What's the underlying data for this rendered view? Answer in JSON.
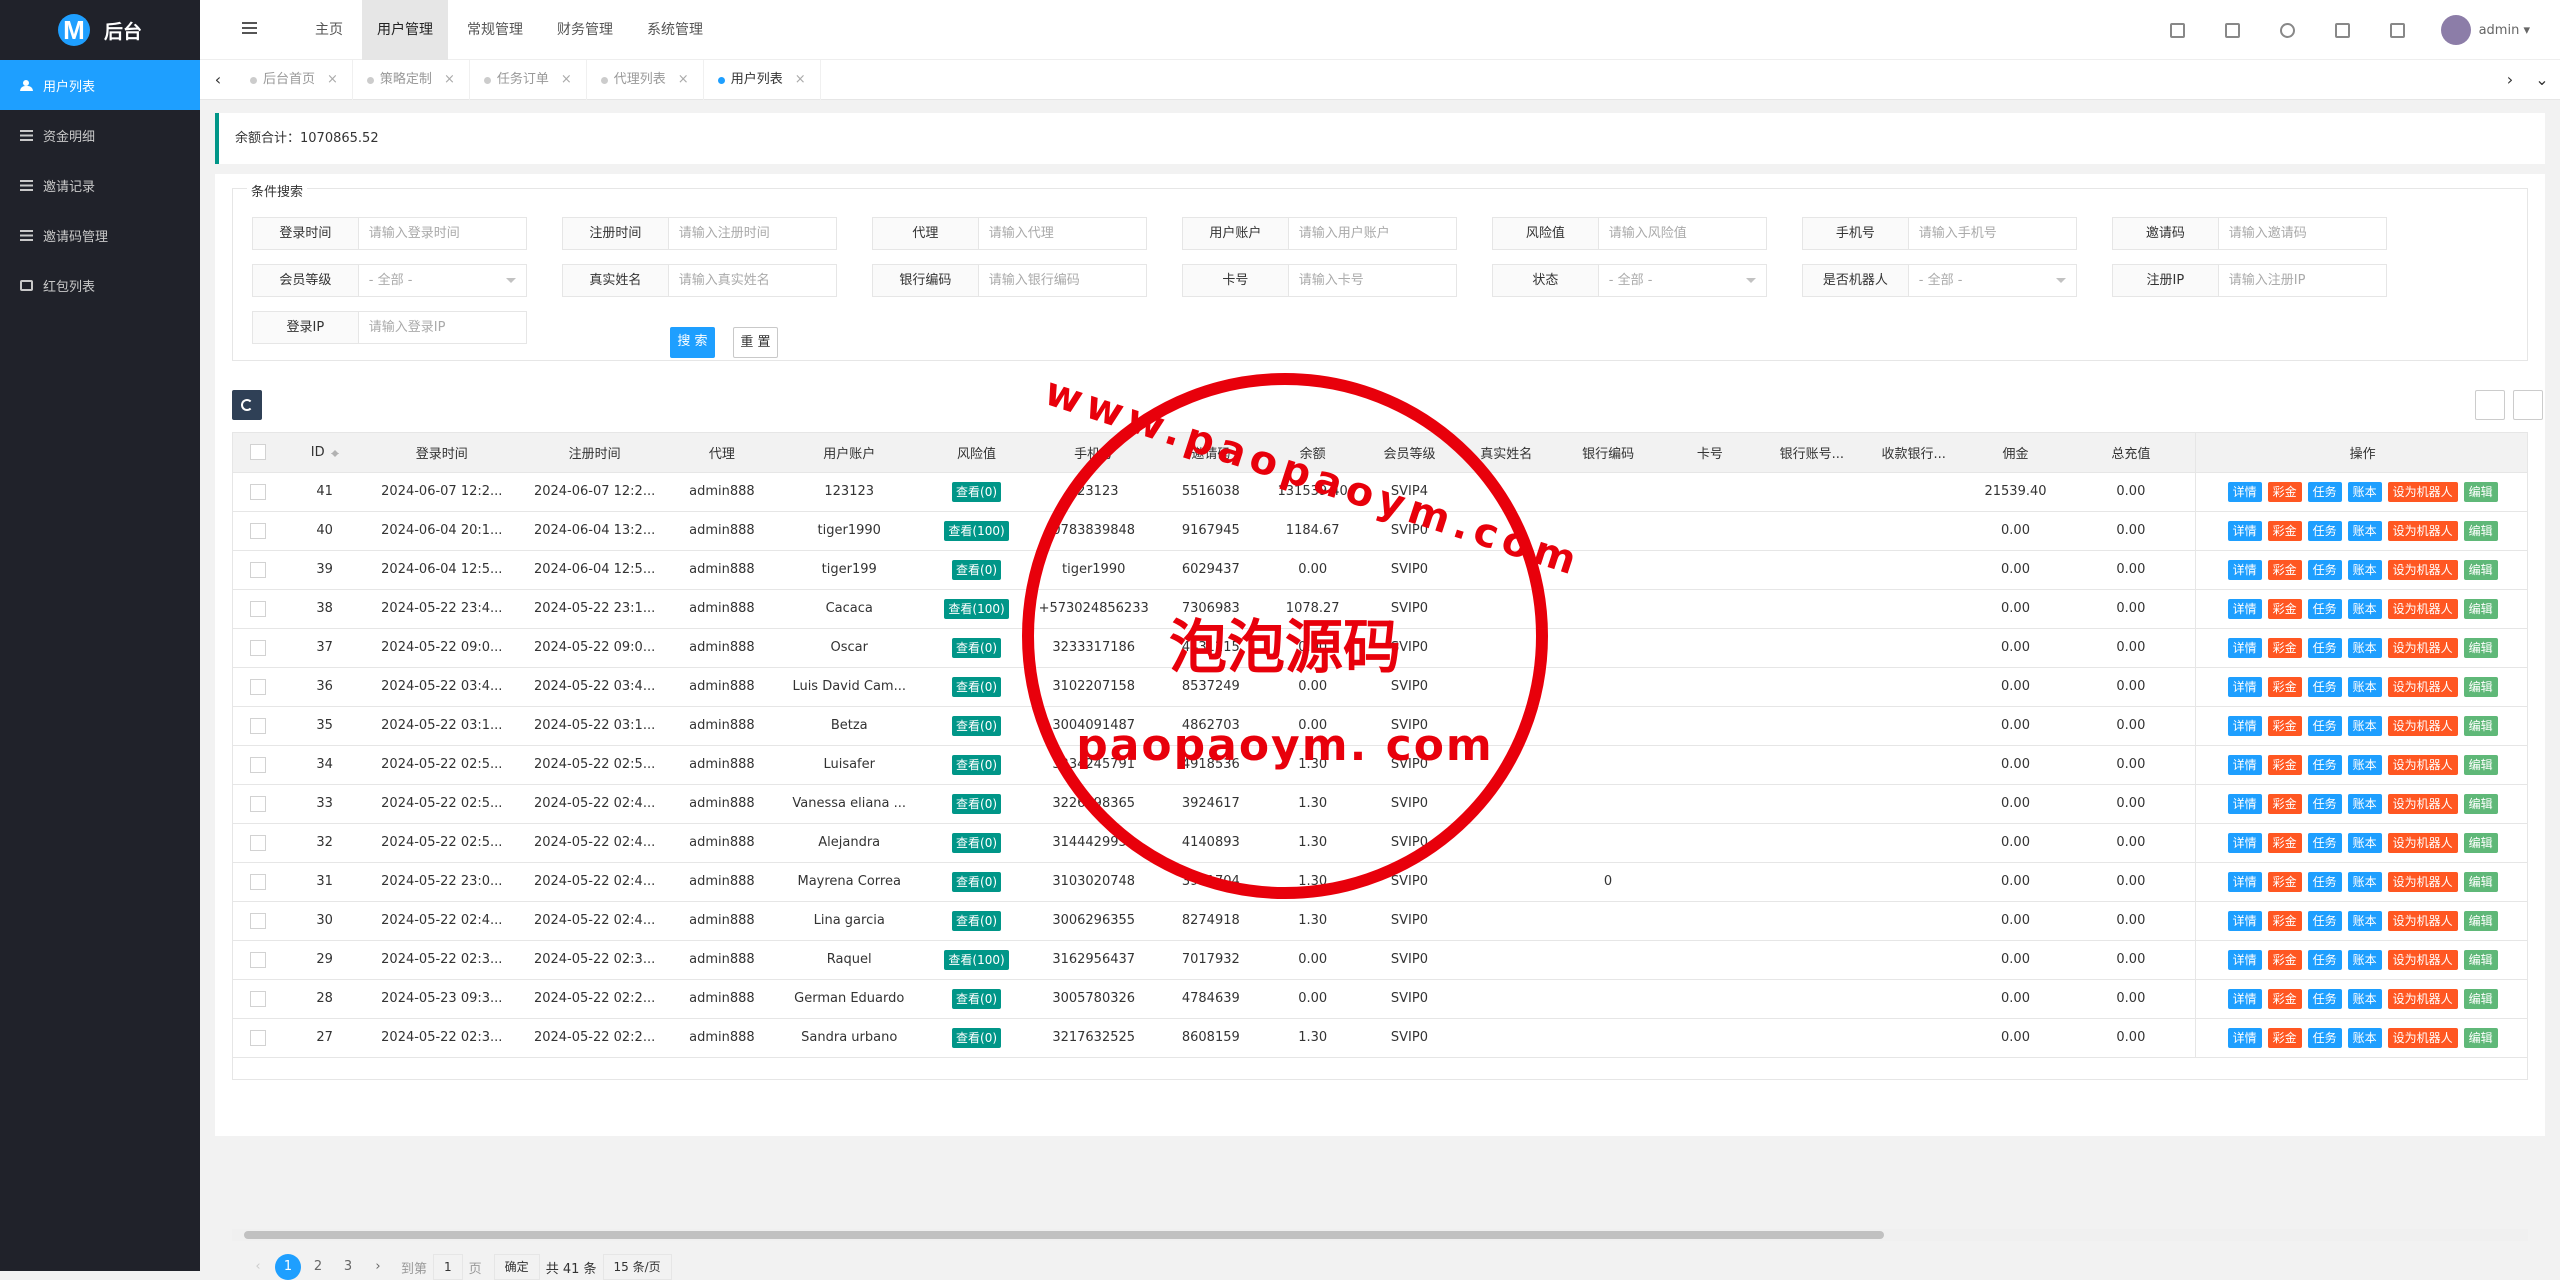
{
  "brand": {
    "logo_letter": "M",
    "title": "后台"
  },
  "sidebar": {
    "items": [
      {
        "label": "用户列表",
        "icon": "users-icon",
        "active": true
      },
      {
        "label": "资金明细",
        "icon": "list-icon"
      },
      {
        "label": "邀请记录",
        "icon": "list-icon"
      },
      {
        "label": "邀请码管理",
        "icon": "list-icon"
      },
      {
        "label": "红包列表",
        "icon": "gift-icon"
      }
    ]
  },
  "topnav": {
    "items": [
      "主页",
      "用户管理",
      "常规管理",
      "财务管理",
      "系统管理"
    ],
    "active": "用户管理",
    "user": "admin"
  },
  "tabs": [
    {
      "label": "后台首页"
    },
    {
      "label": "策略定制"
    },
    {
      "label": "任务订单"
    },
    {
      "label": "代理列表"
    },
    {
      "label": "用户列表",
      "active": true
    }
  ],
  "summary": {
    "label": "余额合计：",
    "value": "1070865.52"
  },
  "search": {
    "legend": "条件搜索",
    "rows": [
      [
        {
          "label": "登录时间",
          "ph": "请输入登录时间"
        },
        {
          "label": "注册时间",
          "ph": "请输入注册时间"
        },
        {
          "label": "代理",
          "ph": "请输入代理"
        },
        {
          "label": "用户账户",
          "ph": "请输入用户账户"
        },
        {
          "label": "风险值",
          "ph": "请输入风险值"
        },
        {
          "label": "手机号",
          "ph": "请输入手机号"
        },
        {
          "label": "邀请码",
          "ph": "请输入邀请码"
        }
      ],
      [
        {
          "label": "会员等级",
          "ph": "- 全部 -",
          "select": true
        },
        {
          "label": "真实姓名",
          "ph": "请输入真实姓名"
        },
        {
          "label": "银行编码",
          "ph": "请输入银行编码"
        },
        {
          "label": "卡号",
          "ph": "请输入卡号"
        },
        {
          "label": "状态",
          "ph": "- 全部 -",
          "select": true
        },
        {
          "label": "是否机器人",
          "ph": "- 全部 -",
          "select": true
        },
        {
          "label": "注册IP",
          "ph": "请输入注册IP"
        }
      ],
      [
        {
          "label": "登录IP",
          "ph": "请输入登录IP"
        }
      ]
    ],
    "search_btn": "搜 索",
    "reset_btn": "重 置"
  },
  "table": {
    "columns": [
      "ID",
      "登录时间",
      "注册时间",
      "代理",
      "用户账户",
      "风险值",
      "手机号",
      "邀请码",
      "余额",
      "会员等级",
      "真实姓名",
      "银行编码",
      "卡号",
      "银行账号...",
      "收款银行...",
      "佣金",
      "总充值",
      "操作"
    ],
    "actions": [
      "详情",
      "彩金",
      "任务",
      "账本",
      "设为机器人",
      "编辑"
    ],
    "rows": [
      {
        "id": "41",
        "login": "2024-06-07 12:2...",
        "reg": "2024-06-07 12:2...",
        "agent": "admin888",
        "account": "123123",
        "risk": "查看(0)",
        "phone": "123123",
        "invite": "5516038",
        "balance": "131539.40",
        "level": "SVIP4",
        "bank": "",
        "comm": "21539.40",
        "recharge": "0.00"
      },
      {
        "id": "40",
        "login": "2024-06-04 20:1...",
        "reg": "2024-06-04 13:2...",
        "agent": "admin888",
        "account": "tiger1990",
        "risk": "查看(100)",
        "phone": "0783839848",
        "invite": "9167945",
        "balance": "1184.67",
        "level": "SVIP0",
        "bank": "",
        "comm": "0.00",
        "recharge": "0.00"
      },
      {
        "id": "39",
        "login": "2024-06-04 12:5...",
        "reg": "2024-06-04 12:5...",
        "agent": "admin888",
        "account": "tiger199",
        "risk": "查看(0)",
        "phone": "tiger1990",
        "invite": "6029437",
        "balance": "0.00",
        "level": "SVIP0",
        "bank": "",
        "comm": "0.00",
        "recharge": "0.00"
      },
      {
        "id": "38",
        "login": "2024-05-22 23:4...",
        "reg": "2024-05-22 23:1...",
        "agent": "admin888",
        "account": "Cacaca",
        "risk": "查看(100)",
        "phone": "+573024856233",
        "invite": "7306983",
        "balance": "1078.27",
        "level": "SVIP0",
        "bank": "",
        "comm": "0.00",
        "recharge": "0.00"
      },
      {
        "id": "37",
        "login": "2024-05-22 09:0...",
        "reg": "2024-05-22 09:0...",
        "agent": "admin888",
        "account": "Oscar",
        "risk": "查看(0)",
        "phone": "3233317186",
        "invite": "4431215",
        "balance": "0.00",
        "level": "SVIP0",
        "bank": "",
        "comm": "0.00",
        "recharge": "0.00"
      },
      {
        "id": "36",
        "login": "2024-05-22 03:4...",
        "reg": "2024-05-22 03:4...",
        "agent": "admin888",
        "account": "Luis David Cam...",
        "risk": "查看(0)",
        "phone": "3102207158",
        "invite": "8537249",
        "balance": "0.00",
        "level": "SVIP0",
        "bank": "",
        "comm": "0.00",
        "recharge": "0.00"
      },
      {
        "id": "35",
        "login": "2024-05-22 03:1...",
        "reg": "2024-05-22 03:1...",
        "agent": "admin888",
        "account": "Betza",
        "risk": "查看(0)",
        "phone": "3004091487",
        "invite": "4862703",
        "balance": "0.00",
        "level": "SVIP0",
        "bank": "",
        "comm": "0.00",
        "recharge": "0.00"
      },
      {
        "id": "34",
        "login": "2024-05-22 02:5...",
        "reg": "2024-05-22 02:5...",
        "agent": "admin888",
        "account": "Luisafer",
        "risk": "查看(0)",
        "phone": "3234245791",
        "invite": "4918536",
        "balance": "1.30",
        "level": "SVIP0",
        "bank": "",
        "comm": "0.00",
        "recharge": "0.00"
      },
      {
        "id": "33",
        "login": "2024-05-22 02:5...",
        "reg": "2024-05-22 02:4...",
        "agent": "admin888",
        "account": "Vanessa eliana ...",
        "risk": "查看(0)",
        "phone": "3226598365",
        "invite": "3924617",
        "balance": "1.30",
        "level": "SVIP0",
        "bank": "",
        "comm": "0.00",
        "recharge": "0.00"
      },
      {
        "id": "32",
        "login": "2024-05-22 02:5...",
        "reg": "2024-05-22 02:4...",
        "agent": "admin888",
        "account": "Alejandra",
        "risk": "查看(0)",
        "phone": "3144429955",
        "invite": "4140893",
        "balance": "1.30",
        "level": "SVIP0",
        "bank": "",
        "comm": "0.00",
        "recharge": "0.00"
      },
      {
        "id": "31",
        "login": "2024-05-22 23:0...",
        "reg": "2024-05-22 02:4...",
        "agent": "admin888",
        "account": "Mayrena Correa",
        "risk": "查看(0)",
        "phone": "3103020748",
        "invite": "3951704",
        "balance": "1.30",
        "level": "SVIP0",
        "bank": "0",
        "comm": "0.00",
        "recharge": "0.00"
      },
      {
        "id": "30",
        "login": "2024-05-22 02:4...",
        "reg": "2024-05-22 02:4...",
        "agent": "admin888",
        "account": "Lina garcia",
        "risk": "查看(0)",
        "phone": "3006296355",
        "invite": "8274918",
        "balance": "1.30",
        "level": "SVIP0",
        "bank": "",
        "comm": "0.00",
        "recharge": "0.00"
      },
      {
        "id": "29",
        "login": "2024-05-22 02:3...",
        "reg": "2024-05-22 02:3...",
        "agent": "admin888",
        "account": "Raquel",
        "risk": "查看(100)",
        "phone": "3162956437",
        "invite": "7017932",
        "balance": "0.00",
        "level": "SVIP0",
        "bank": "",
        "comm": "0.00",
        "recharge": "0.00"
      },
      {
        "id": "28",
        "login": "2024-05-23 09:3...",
        "reg": "2024-05-22 02:2...",
        "agent": "admin888",
        "account": "German Eduardo",
        "risk": "查看(0)",
        "phone": "3005780326",
        "invite": "4784639",
        "balance": "0.00",
        "level": "SVIP0",
        "bank": "",
        "comm": "0.00",
        "recharge": "0.00"
      },
      {
        "id": "27",
        "login": "2024-05-22 02:3...",
        "reg": "2024-05-22 02:2...",
        "agent": "admin888",
        "account": "Sandra urbano",
        "risk": "查看(0)",
        "phone": "3217632525",
        "invite": "8608159",
        "balance": "1.30",
        "level": "SVIP0",
        "bank": "",
        "comm": "0.00",
        "recharge": "0.00"
      }
    ]
  },
  "pager": {
    "pages": [
      "1",
      "2",
      "3"
    ],
    "current": "1",
    "goto": "到第",
    "page_value": "1",
    "page_unit": "页",
    "confirm": "确定",
    "total": "共 41 条",
    "per_page": "15 条/页"
  },
  "watermark": {
    "line1": "www.paopaoym.com",
    "line2": "泡泡源码",
    "line3": "paopaoym. com"
  }
}
